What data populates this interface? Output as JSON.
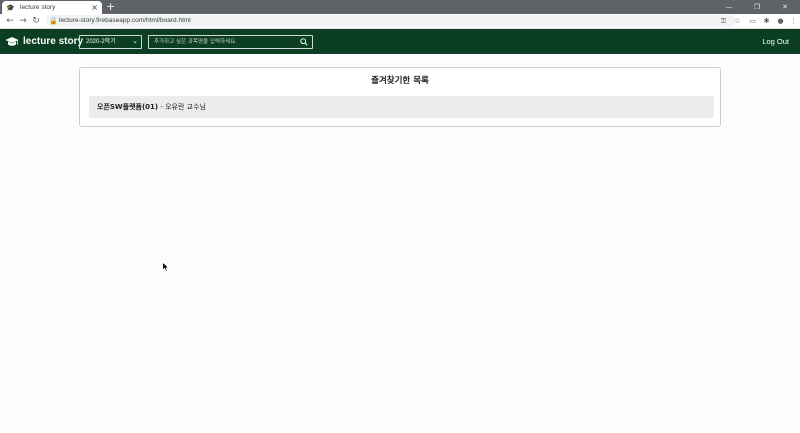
{
  "browser": {
    "tab_title": "lecture story",
    "tab_close": "×",
    "new_tab": "+",
    "url": "lecture-story.firebaseapp.com/html/board.html"
  },
  "header": {
    "brand": "lecture story",
    "semester_select": "2020-2학기",
    "search_placeholder": "추가하고 싶은 과목명을 입력하세요.",
    "logout": "Log Out"
  },
  "favorites": {
    "title": "즐겨찾기한 목록",
    "items": [
      {
        "course": "오픈SW플랫폼(01)",
        "separator": " - ",
        "professor": "오유란 교수님"
      }
    ]
  },
  "colors": {
    "header_bg": "#0b3e22",
    "item_bg": "#ececef"
  }
}
